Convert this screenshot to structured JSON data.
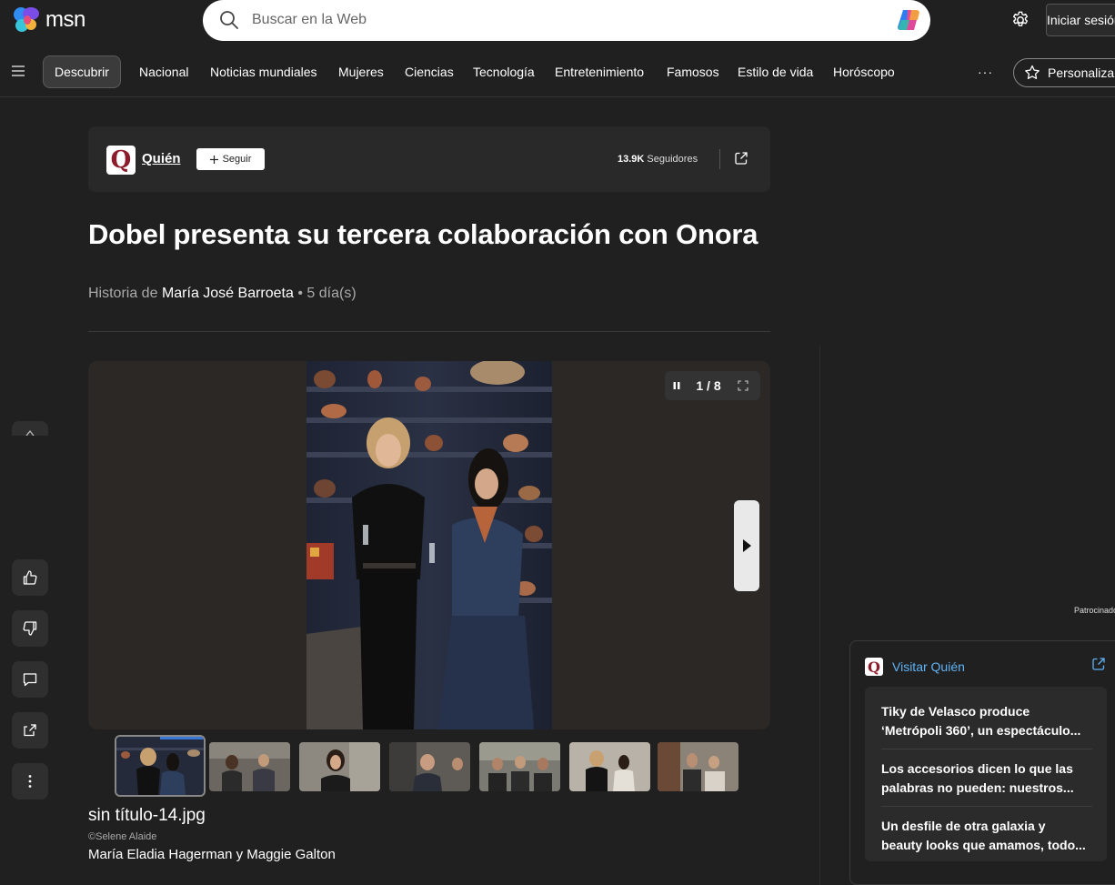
{
  "brand": {
    "name": "msn"
  },
  "search": {
    "placeholder": "Buscar en la Web"
  },
  "header": {
    "signin_label": "Iniciar sesión"
  },
  "nav": {
    "items": [
      {
        "label": "Descubrir",
        "active": true
      },
      {
        "label": "Nacional"
      },
      {
        "label": "Noticias mundiales"
      },
      {
        "label": "Mujeres"
      },
      {
        "label": "Ciencias"
      },
      {
        "label": "Tecnología"
      },
      {
        "label": "Entretenimiento"
      },
      {
        "label": "Famosos"
      },
      {
        "label": "Estilo de vida"
      },
      {
        "label": "Horóscopo"
      }
    ],
    "more_label": "···",
    "personalize_label": "Personalizar"
  },
  "publisher": {
    "logo_letter": "Q",
    "name": "Quién",
    "follow_label": "Seguir",
    "followers_count": "13.9K",
    "followers_label": "Seguidores",
    "brand_color": "#8c1c2b"
  },
  "article": {
    "title": "Dobel presenta su tercera colaboración con Onora",
    "byline_prefix": "Historia de",
    "author": "María José Barroeta",
    "age": "5 día(s)"
  },
  "gallery": {
    "counter": "1 / 8",
    "current_index": 1,
    "total": 8,
    "thumbnail_count": 7,
    "caption_title": "sin título-14.jpg",
    "caption_credit": "©Selene Alaide",
    "caption_text": "María Eladia Hagerman y Maggie Galton"
  },
  "sidebar": {
    "sponsored_label": "Patrocinado",
    "visit_label": "Visitar Quién",
    "stories": [
      {
        "line1": "Tiky de Velasco produce",
        "line2": "‘Metrópoli 360’, un espectáculo..."
      },
      {
        "line1": "Los accesorios dicen lo que las",
        "line2": "palabras no pueden: nuestros..."
      },
      {
        "line1": "Un desfile de otra galaxia y",
        "line2": "beauty looks que amamos, todo..."
      }
    ]
  },
  "colors": {
    "background": "#202020",
    "accent_link": "#5fb3f5",
    "progress": "#3a78d8"
  }
}
